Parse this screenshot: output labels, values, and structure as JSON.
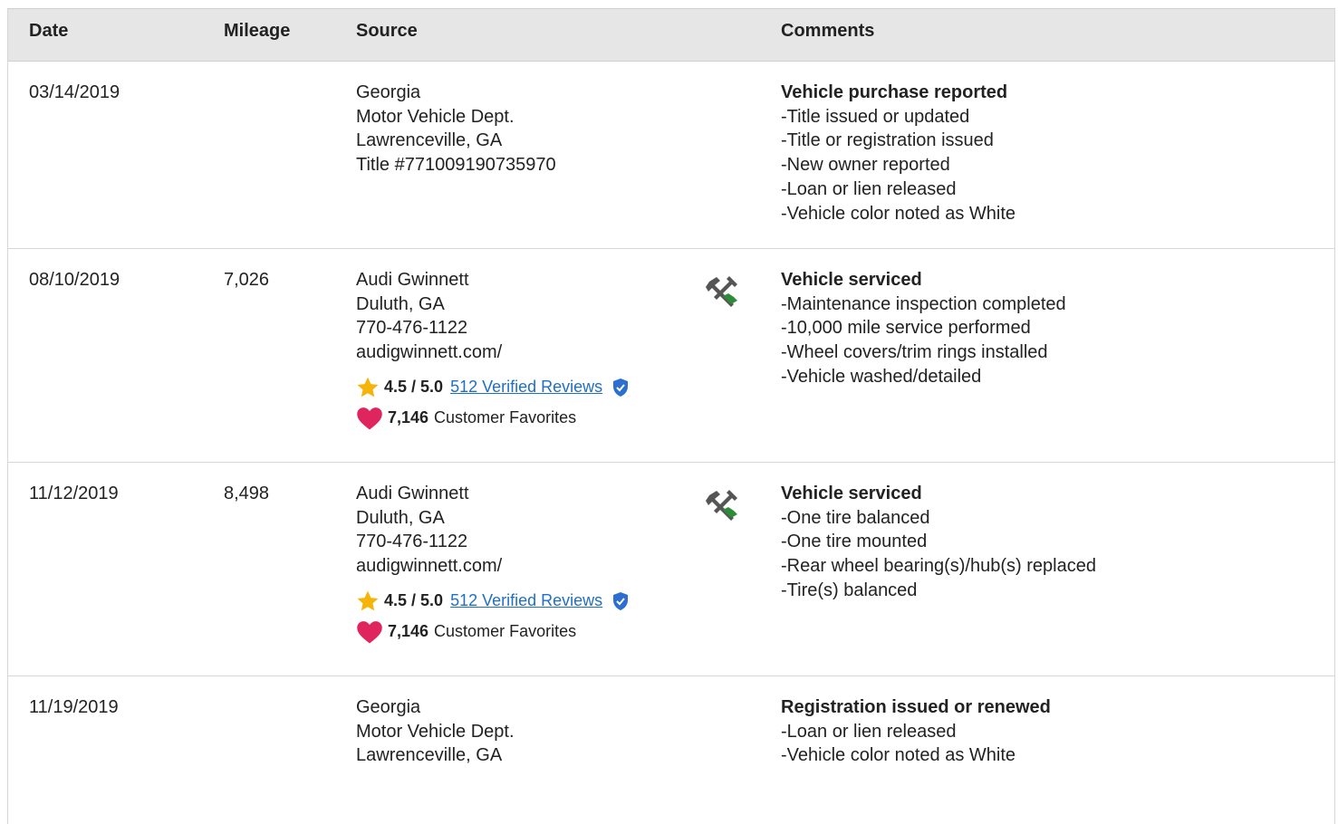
{
  "header": {
    "date": "Date",
    "mileage": "Mileage",
    "source": "Source",
    "comments": "Comments"
  },
  "rows": [
    {
      "date": "03/14/2019",
      "mileage": "",
      "source": [
        "Georgia",
        "Motor Vehicle Dept.",
        "Lawrenceville, GA",
        "Title #771009190735970"
      ],
      "comments_title": "Vehicle purchase reported",
      "comments": [
        "Title issued or updated",
        "Title or registration issued",
        "New owner reported",
        "Loan or lien released",
        "Vehicle color noted as White"
      ]
    },
    {
      "date": "08/10/2019",
      "mileage": "7,026",
      "source": [
        "Audi Gwinnett",
        "Duluth, GA",
        "770-476-1122",
        "audigwinnett.com/"
      ],
      "rating": "4.5 / 5.0",
      "reviews_link": "512 Verified Reviews",
      "favorites_count": "7,146",
      "favorites_label": "Customer Favorites",
      "icon": "service-tools-icon",
      "comments_title": "Vehicle serviced",
      "comments": [
        "Maintenance inspection completed",
        "10,000 mile service performed",
        "Wheel covers/trim rings installed",
        "Vehicle washed/detailed"
      ]
    },
    {
      "date": "11/12/2019",
      "mileage": "8,498",
      "source": [
        "Audi Gwinnett",
        "Duluth, GA",
        "770-476-1122",
        "audigwinnett.com/"
      ],
      "rating": "4.5 / 5.0",
      "reviews_link": "512 Verified Reviews",
      "favorites_count": "7,146",
      "favorites_label": "Customer Favorites",
      "icon": "service-tools-icon",
      "comments_title": "Vehicle serviced",
      "comments": [
        "One tire balanced",
        "One tire mounted",
        "Rear wheel bearing(s)/hub(s) replaced",
        "Tire(s) balanced"
      ]
    },
    {
      "date": "11/19/2019",
      "mileage": "",
      "source": [
        "Georgia",
        "Motor Vehicle Dept.",
        "Lawrenceville, GA"
      ],
      "comments_title": "Registration issued or renewed",
      "comments": [
        "Loan or lien released",
        "Vehicle color noted as White"
      ]
    }
  ],
  "colors": {
    "header_bg": "#e6e6e6",
    "link": "#1f6fc7",
    "star": "#f5b40a",
    "heart": "#e0245e",
    "tool_green": "#2e8b3a",
    "tool_gray": "#555555",
    "shield": "#2d6fd0"
  }
}
